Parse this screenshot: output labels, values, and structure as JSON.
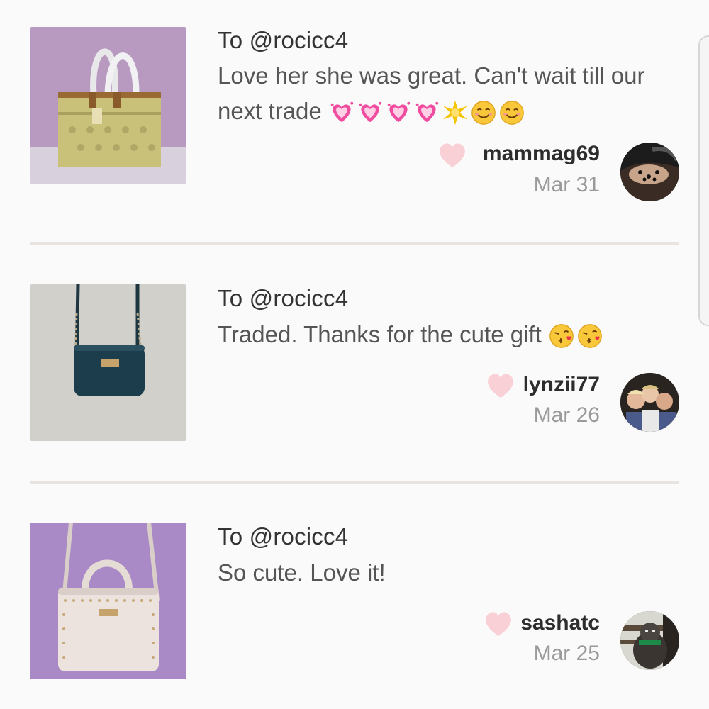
{
  "reviews": [
    {
      "to": "To @rocicc4",
      "message": "Love her she was great. Can't wait till our next trade",
      "emojis": [
        "sparkling-heart",
        "sparkling-heart",
        "sparkling-heart",
        "sparkling-heart",
        "sparkle-star",
        "smiling-face",
        "smiling-face"
      ],
      "username": "mammag69",
      "date": "Mar 31",
      "item_image": "tan-monogram-tote-bag",
      "avatar": "user-avatar"
    },
    {
      "to": "To @rocicc4",
      "message": "Traded. Thanks for the cute gift",
      "emojis": [
        "kissing-face",
        "kissing-face"
      ],
      "username": "lynzii77",
      "date": "Mar 26",
      "item_image": "navy-crossbody-bag",
      "avatar": "user-avatar"
    },
    {
      "to": "To @rocicc4",
      "message": "So cute. Love it!",
      "emojis": [],
      "username": "sashatc",
      "date": "Mar 25",
      "item_image": "blush-studded-satchel",
      "avatar": "user-avatar"
    }
  ],
  "colors": {
    "heart": "#f9d0d6",
    "divider": "#e8e4e2",
    "username": "#2d2d2d",
    "date": "#9a9a9a"
  }
}
